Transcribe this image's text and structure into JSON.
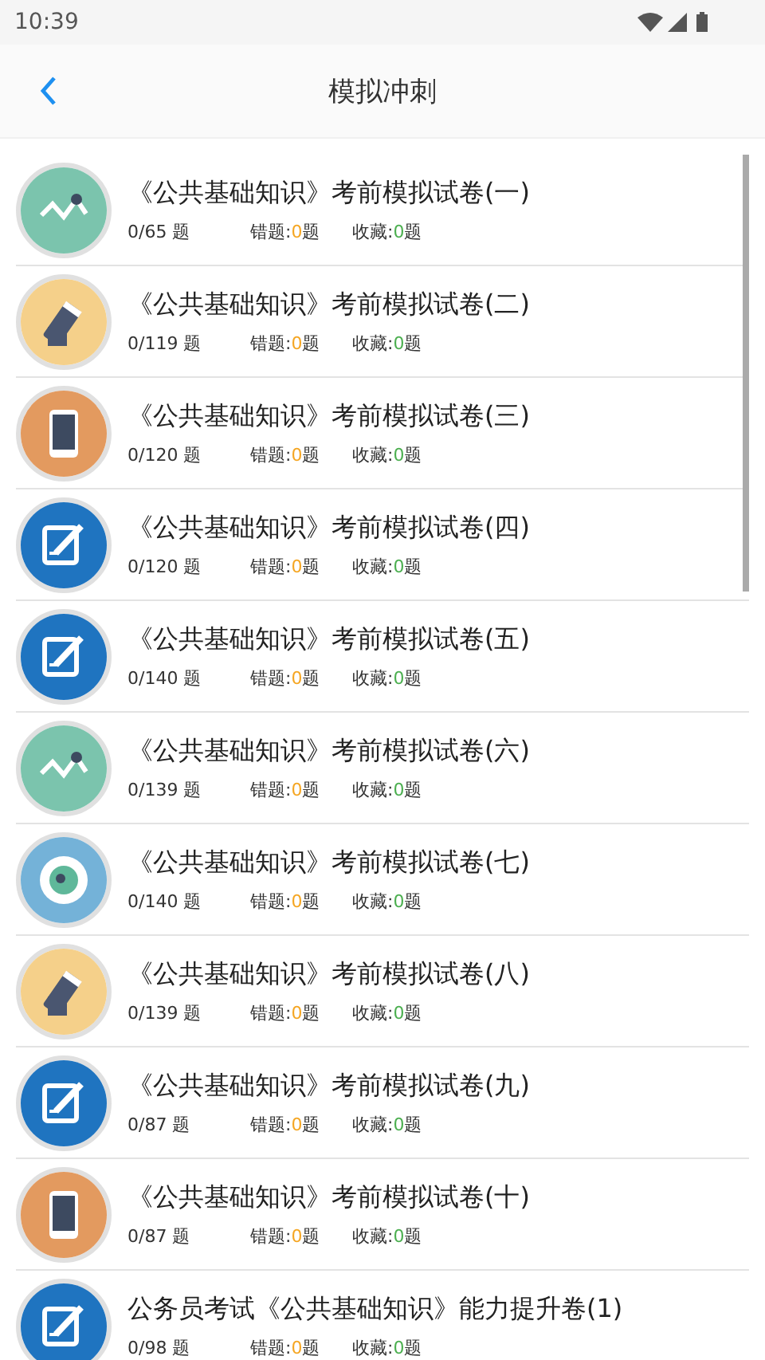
{
  "status_bar": {
    "time": "10:39"
  },
  "header": {
    "title": "模拟冲刺"
  },
  "papers": [
    {
      "kind": "wave",
      "title": "《公共基础知识》考前模拟试卷(一)",
      "progress": "0/65 题",
      "wrong": {
        "label": "错题:",
        "count": "0",
        "unit": "题"
      },
      "fav": {
        "label": "收藏:",
        "count": "0",
        "unit": "题"
      }
    },
    {
      "kind": "pencil",
      "title": "《公共基础知识》考前模拟试卷(二)",
      "progress": "0/119 题",
      "wrong": {
        "label": "错题:",
        "count": "0",
        "unit": "题"
      },
      "fav": {
        "label": "收藏:",
        "count": "0",
        "unit": "题"
      }
    },
    {
      "kind": "phone",
      "title": "《公共基础知识》考前模拟试卷(三)",
      "progress": "0/120 题",
      "wrong": {
        "label": "错题:",
        "count": "0",
        "unit": "题"
      },
      "fav": {
        "label": "收藏:",
        "count": "0",
        "unit": "题"
      }
    },
    {
      "kind": "edit",
      "title": "《公共基础知识》考前模拟试卷(四)",
      "progress": "0/120 题",
      "wrong": {
        "label": "错题:",
        "count": "0",
        "unit": "题"
      },
      "fav": {
        "label": "收藏:",
        "count": "0",
        "unit": "题"
      }
    },
    {
      "kind": "edit",
      "title": "《公共基础知识》考前模拟试卷(五)",
      "progress": "0/140 题",
      "wrong": {
        "label": "错题:",
        "count": "0",
        "unit": "题"
      },
      "fav": {
        "label": "收藏:",
        "count": "0",
        "unit": "题"
      }
    },
    {
      "kind": "wave",
      "title": "《公共基础知识》考前模拟试卷(六)",
      "progress": "0/139 题",
      "wrong": {
        "label": "错题:",
        "count": "0",
        "unit": "题"
      },
      "fav": {
        "label": "收藏:",
        "count": "0",
        "unit": "题"
      }
    },
    {
      "kind": "eye",
      "title": "《公共基础知识》考前模拟试卷(七)",
      "progress": "0/140 题",
      "wrong": {
        "label": "错题:",
        "count": "0",
        "unit": "题"
      },
      "fav": {
        "label": "收藏:",
        "count": "0",
        "unit": "题"
      }
    },
    {
      "kind": "pencil",
      "title": "《公共基础知识》考前模拟试卷(八)",
      "progress": "0/139 题",
      "wrong": {
        "label": "错题:",
        "count": "0",
        "unit": "题"
      },
      "fav": {
        "label": "收藏:",
        "count": "0",
        "unit": "题"
      }
    },
    {
      "kind": "edit",
      "title": "《公共基础知识》考前模拟试卷(九)",
      "progress": "0/87 题",
      "wrong": {
        "label": "错题:",
        "count": "0",
        "unit": "题"
      },
      "fav": {
        "label": "收藏:",
        "count": "0",
        "unit": "题"
      }
    },
    {
      "kind": "phone",
      "title": "《公共基础知识》考前模拟试卷(十)",
      "progress": "0/87 题",
      "wrong": {
        "label": "错题:",
        "count": "0",
        "unit": "题"
      },
      "fav": {
        "label": "收藏:",
        "count": "0",
        "unit": "题"
      }
    },
    {
      "kind": "edit",
      "title": "公务员考试《公共基础知识》能力提升卷(1)",
      "progress": "0/98 题",
      "wrong": {
        "label": "错题:",
        "count": "0",
        "unit": "题"
      },
      "fav": {
        "label": "收藏:",
        "count": "0",
        "unit": "题"
      }
    }
  ]
}
